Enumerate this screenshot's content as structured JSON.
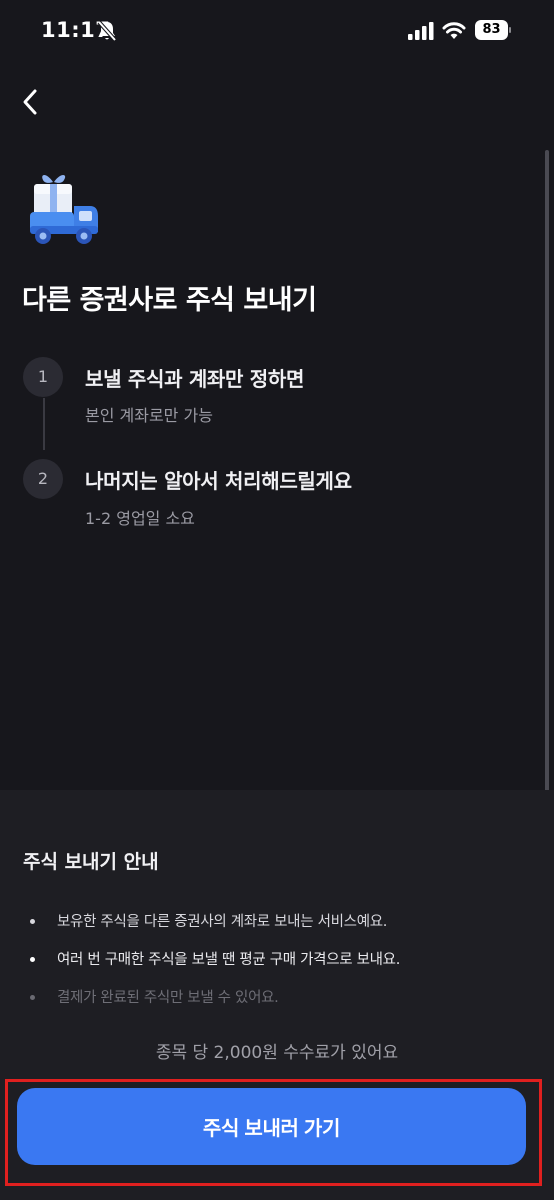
{
  "status_bar": {
    "time": "11:17",
    "battery": "83"
  },
  "header": {
    "back_icon": "chevron-left-icon"
  },
  "hero": {
    "icon": "delivery-truck-icon",
    "title": "다른 증권사로 주식 보내기"
  },
  "steps": [
    {
      "number": "1",
      "title": "보낼 주식과 계좌만 정하면",
      "subtitle": "본인 계좌로만 가능"
    },
    {
      "number": "2",
      "title": "나머지는 알아서 처리해드릴게요",
      "subtitle": "1-2 영업일 소요"
    }
  ],
  "info": {
    "title": "주식 보내기 안내",
    "bullets": [
      "보유한 주식을 다른 증권사의 계좌로 보내는 서비스예요.",
      "여러 번 구매한 주식을 보낼 땐 평균 구매 가격으로 보내요.",
      "결제가 완료된 주식만 보낼 수 있어요."
    ],
    "fee": "종목 당 2,000원 수수료가 있어요"
  },
  "cta": {
    "label": "주식 보내러 가기"
  },
  "colors": {
    "background": "#17171c",
    "panel": "#1e1e23",
    "primary": "#3a78f2",
    "highlight": "#e0201f"
  }
}
